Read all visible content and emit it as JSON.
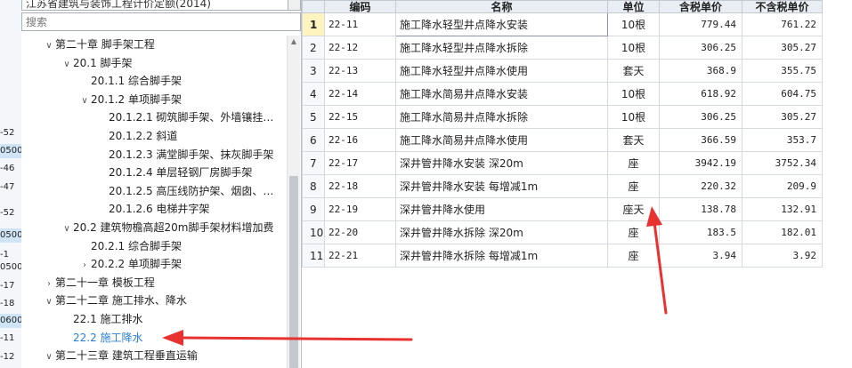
{
  "left_strip": {
    "items": [
      {
        "text": "-52",
        "highlight": false
      },
      {
        "text": "0500",
        "highlight": true
      },
      {
        "text": "-46",
        "highlight": false
      },
      {
        "text": "-47",
        "highlight": false
      },
      {
        "text": "-52",
        "highlight": false
      },
      {
        "text": "0500",
        "highlight": true
      },
      {
        "text": "-1",
        "highlight": false
      },
      {
        "text": "0500",
        "highlight": false
      },
      {
        "text": "-17",
        "highlight": false
      },
      {
        "text": "-18",
        "highlight": false
      },
      {
        "text": "0600",
        "highlight": true
      },
      {
        "text": "-11",
        "highlight": false
      },
      {
        "text": "-12",
        "highlight": false
      }
    ]
  },
  "library": {
    "selected": "江苏省建筑与装饰工程计价定额(2014)"
  },
  "search": {
    "placeholder": "搜索",
    "value": ""
  },
  "tree": {
    "nodes": [
      {
        "label": "第二十章 脚手架工程",
        "toggle": "down",
        "level": 0,
        "selected": false
      },
      {
        "label": "20.1 脚手架",
        "toggle": "down",
        "level": 1,
        "selected": false
      },
      {
        "label": "20.1.1 综合脚手架",
        "toggle": "",
        "level": 2,
        "selected": false
      },
      {
        "label": "20.1.2 单项脚手架",
        "toggle": "down",
        "level": 2,
        "selected": false
      },
      {
        "label": "20.1.2.1 砌筑脚手架、外墙镶挂…",
        "toggle": "",
        "level": 3,
        "selected": false
      },
      {
        "label": "20.1.2.2 斜道",
        "toggle": "",
        "level": 3,
        "selected": false
      },
      {
        "label": "20.1.2.3 满堂脚手架、抹灰脚手架",
        "toggle": "",
        "level": 3,
        "selected": false
      },
      {
        "label": "20.1.2.4 单层轻钢厂房脚手架",
        "toggle": "",
        "level": 3,
        "selected": false
      },
      {
        "label": "20.1.2.5 高压线防护架、烟囱、…",
        "toggle": "",
        "level": 3,
        "selected": false
      },
      {
        "label": "20.1.2.6 电梯井字架",
        "toggle": "",
        "level": 3,
        "selected": false
      },
      {
        "label": "20.2 建筑物檐高超20m脚手架材料增加费",
        "toggle": "down",
        "level": 1,
        "selected": false
      },
      {
        "label": "20.2.1 综合脚手架",
        "toggle": "",
        "level": 2,
        "selected": false
      },
      {
        "label": "20.2.2 单项脚手架",
        "toggle": "right",
        "level": 2,
        "selected": false
      },
      {
        "label": "第二十一章 模板工程",
        "toggle": "right",
        "level": 0,
        "selected": false
      },
      {
        "label": "第二十二章 施工排水、降水",
        "toggle": "down",
        "level": 0,
        "selected": false
      },
      {
        "label": "22.1 施工排水",
        "toggle": "",
        "level": 1,
        "selected": false
      },
      {
        "label": "22.2 施工降水",
        "toggle": "",
        "level": 1,
        "selected": true
      },
      {
        "label": "第二十三章 建筑工程垂直运输",
        "toggle": "down",
        "level": 0,
        "selected": false
      }
    ]
  },
  "grid": {
    "headers": [
      "",
      "编码",
      "名称",
      "单位",
      "含税单价",
      "不含税单价"
    ],
    "rows": [
      {
        "no": "1",
        "code": "22-11",
        "name": "施工降水轻型井点降水安装",
        "unit": "10根",
        "price_tax": "779.44",
        "price_notax": "761.22"
      },
      {
        "no": "2",
        "code": "22-12",
        "name": "施工降水轻型井点降水拆除",
        "unit": "10根",
        "price_tax": "306.25",
        "price_notax": "305.27"
      },
      {
        "no": "3",
        "code": "22-13",
        "name": "施工降水轻型井点降水使用",
        "unit": "套天",
        "price_tax": "368.9",
        "price_notax": "355.75"
      },
      {
        "no": "4",
        "code": "22-14",
        "name": "施工降水简易井点降水安装",
        "unit": "10根",
        "price_tax": "618.92",
        "price_notax": "604.75"
      },
      {
        "no": "5",
        "code": "22-15",
        "name": "施工降水简易井点降水拆除",
        "unit": "10根",
        "price_tax": "306.25",
        "price_notax": "305.27"
      },
      {
        "no": "6",
        "code": "22-16",
        "name": "施工降水简易井点降水使用",
        "unit": "套天",
        "price_tax": "366.59",
        "price_notax": "353.7"
      },
      {
        "no": "7",
        "code": "22-17",
        "name": "深井管井降水安装 深20m",
        "unit": "座",
        "price_tax": "3942.19",
        "price_notax": "3752.34"
      },
      {
        "no": "8",
        "code": "22-18",
        "name": "深井管井降水安装 每增减1m",
        "unit": "座",
        "price_tax": "220.32",
        "price_notax": "209.9"
      },
      {
        "no": "9",
        "code": "22-19",
        "name": "深井管井降水使用",
        "unit": "座天",
        "price_tax": "138.78",
        "price_notax": "132.91"
      },
      {
        "no": "10",
        "code": "22-20",
        "name": "深井管井降水拆除 深20m",
        "unit": "座",
        "price_tax": "183.5",
        "price_notax": "182.01"
      },
      {
        "no": "11",
        "code": "22-21",
        "name": "深井管井降水拆除 每增减1m",
        "unit": "座",
        "price_tax": "3.94",
        "price_notax": "3.92"
      }
    ]
  },
  "colors": {
    "annotation_arrow": "#e8322f",
    "selected_tree_text": "#2a7fd4",
    "active_row_number": "#fff3bf",
    "header_bg": "#e9eef5"
  }
}
